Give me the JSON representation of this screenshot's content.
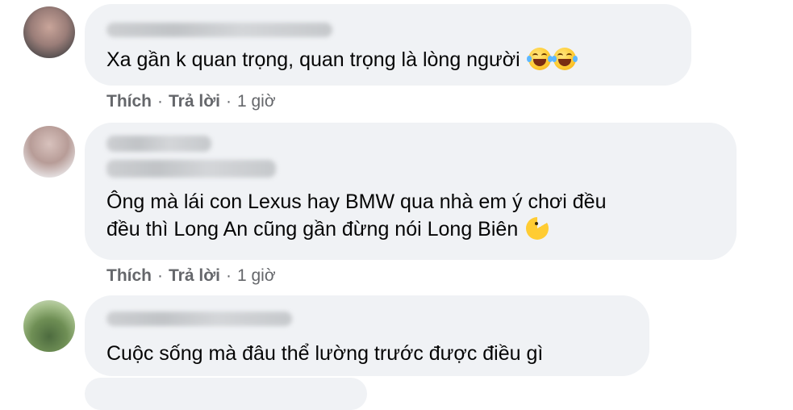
{
  "comments": [
    {
      "text": "Xa gần k quan trọng, quan trọng là lòng người",
      "emojis": [
        "face-with-tears-of-joy-icon",
        "face-with-tears-of-joy-icon"
      ],
      "actions": {
        "like": "Thích",
        "reply": "Trả lời",
        "time": "1 giờ"
      }
    },
    {
      "text": "Ông mà lái con Lexus hay BMW qua nhà em ý chơi đều",
      "text_line2": "đều thì Long An cũng gần đừng nói Long Biên",
      "emojis": [
        "pacman-icon"
      ],
      "actions": {
        "like": "Thích",
        "reply": "Trả lời",
        "time": "1 giờ"
      }
    },
    {
      "text": "Cuộc sống mà đâu thể lường trước được điều gì"
    }
  ],
  "separator": "·",
  "colors": {
    "bubble": "#f0f2f5",
    "action_text": "#65676b",
    "text": "#050505"
  }
}
